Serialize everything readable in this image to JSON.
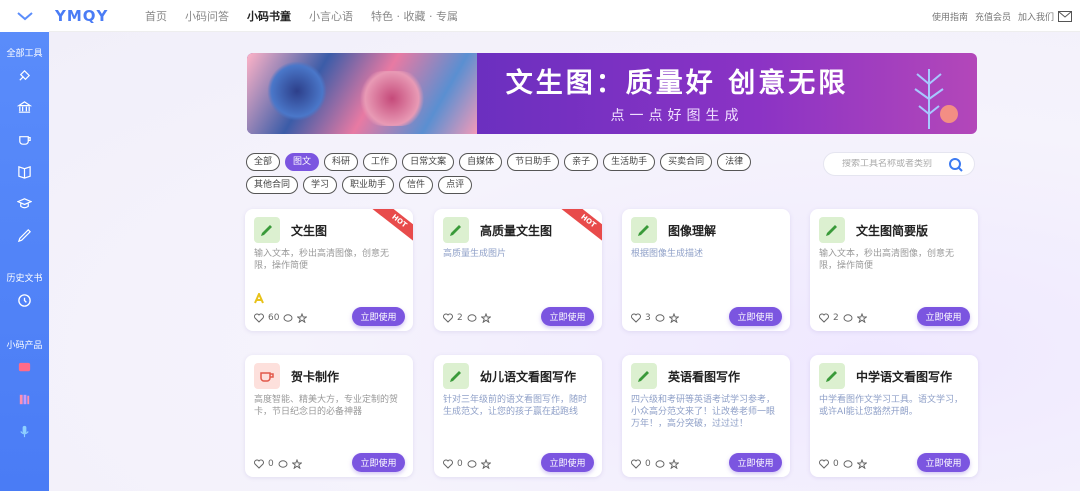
{
  "brand": {
    "logo": "YMQY",
    "accent": "#7b55e0",
    "sidebar_color": "#4a7cf5"
  },
  "topnav": {
    "items": [
      "首页",
      "小码问答",
      "小码书童",
      "小言心语",
      "特色 · 收藏 · 专属"
    ],
    "active_index": 2,
    "right": {
      "guide": "使用指南",
      "vip": "充值会员",
      "join": "加入我们"
    }
  },
  "sidebar": {
    "sections": [
      {
        "label": "全部工具",
        "icons": [
          "brush-icon",
          "bank-icon",
          "cup-icon",
          "book-icon",
          "graduation-cap-icon",
          "pen-icon"
        ]
      },
      {
        "label": "历史文书",
        "icons": [
          "history-icon"
        ]
      },
      {
        "label": "小码产品",
        "icons": [
          "chat-icon",
          "books-icon",
          "mic-icon"
        ]
      }
    ]
  },
  "banner": {
    "title": "文生图：质量好 创意无限",
    "subtitle": "点一点好图生成"
  },
  "tags": [
    "全部",
    "图文",
    "科研",
    "工作",
    "日常文案",
    "自媒体",
    "节日助手",
    "亲子",
    "生活助手",
    "买卖合同",
    "法律",
    "其他合同",
    "学习",
    "职业助手",
    "信件",
    "点评"
  ],
  "active_tag_index": 1,
  "search": {
    "placeholder": "搜索工具名称或者类别"
  },
  "cards": [
    {
      "title": "文生图",
      "desc": "输入文本，秒出高清图像，创意无限，操作简便",
      "likes": "60",
      "hot": "HOT",
      "button": "立即使用"
    },
    {
      "title": "高质量文生图",
      "desc": "高质量生成图片",
      "likes": "2",
      "hot": "HOT",
      "button": "立即使用"
    },
    {
      "title": "图像理解",
      "desc": "根据图像生成描述",
      "likes": "3",
      "button": "立即使用"
    },
    {
      "title": "文生图简要版",
      "desc": "输入文本，秒出高清图像，创意无限，操作简便",
      "likes": "2",
      "button": "立即使用"
    },
    {
      "title": "贺卡制作",
      "desc": "高度智能、精美大方，专业定制的贺卡，节日纪念日的必备神器",
      "likes": "0",
      "button": "立即使用"
    },
    {
      "title": "幼儿语文看图写作",
      "desc": "针对三年级前的语文看图写作，随时生成范文，让您的孩子赢在起跑线",
      "likes": "0",
      "button": "立即使用"
    },
    {
      "title": "英语看图写作",
      "desc": "四六级和考研等英语考试学习参考，小众高分范文来了！让改卷老师一眼万年！，高分突破，过过过！",
      "likes": "0",
      "button": "立即使用"
    },
    {
      "title": "中学语文看图写作",
      "desc": "中学看图作文学习工具。语文学习，或许AI能让您豁然开朗。",
      "likes": "0",
      "button": "立即使用"
    }
  ]
}
